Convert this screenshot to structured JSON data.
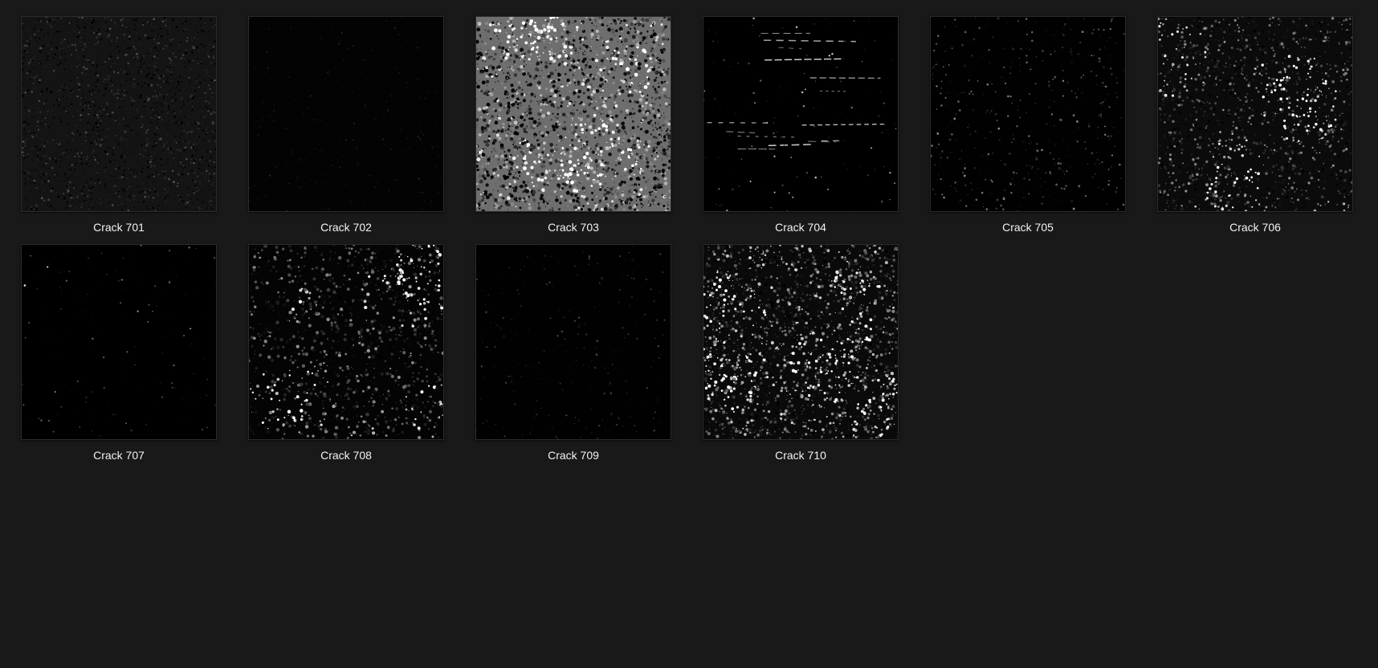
{
  "items": [
    {
      "label": "Crack 701",
      "style": {
        "base": "#141414",
        "density": 2400,
        "bright": 0.32,
        "maxr": 1.2,
        "pattern": "grain"
      }
    },
    {
      "label": "Crack 702",
      "style": {
        "base": "#030303",
        "density": 700,
        "bright": 0.14,
        "maxr": 0.9,
        "pattern": "grain"
      }
    },
    {
      "label": "Crack 703",
      "style": {
        "base": "#6e6e6e",
        "density": 2600,
        "bright": 0.92,
        "maxr": 2.2,
        "pattern": "rough"
      }
    },
    {
      "label": "Crack 704",
      "style": {
        "base": "#000000",
        "density": 160,
        "bright": 0.8,
        "maxr": 1.0,
        "pattern": "horizontal"
      }
    },
    {
      "label": "Crack 705",
      "style": {
        "base": "#010101",
        "density": 700,
        "bright": 0.55,
        "maxr": 1.2,
        "pattern": "speckle"
      }
    },
    {
      "label": "Crack 706",
      "style": {
        "base": "#0b0b0b",
        "density": 1800,
        "bright": 0.6,
        "maxr": 1.6,
        "pattern": "rough"
      }
    },
    {
      "label": "Crack 707",
      "style": {
        "base": "#000000",
        "density": 220,
        "bright": 0.5,
        "maxr": 1.0,
        "pattern": "sparse"
      }
    },
    {
      "label": "Crack 708",
      "style": {
        "base": "#040404",
        "density": 1500,
        "bright": 0.6,
        "maxr": 2.0,
        "pattern": "patchy"
      }
    },
    {
      "label": "Crack 709",
      "style": {
        "base": "#010101",
        "density": 450,
        "bright": 0.3,
        "maxr": 1.1,
        "pattern": "speckle"
      }
    },
    {
      "label": "Crack 710",
      "style": {
        "base": "#0a0a0a",
        "density": 2600,
        "bright": 0.85,
        "maxr": 1.8,
        "pattern": "patchy"
      }
    }
  ],
  "colors": {
    "background": "#191919",
    "caption": "#f2f2f2"
  }
}
